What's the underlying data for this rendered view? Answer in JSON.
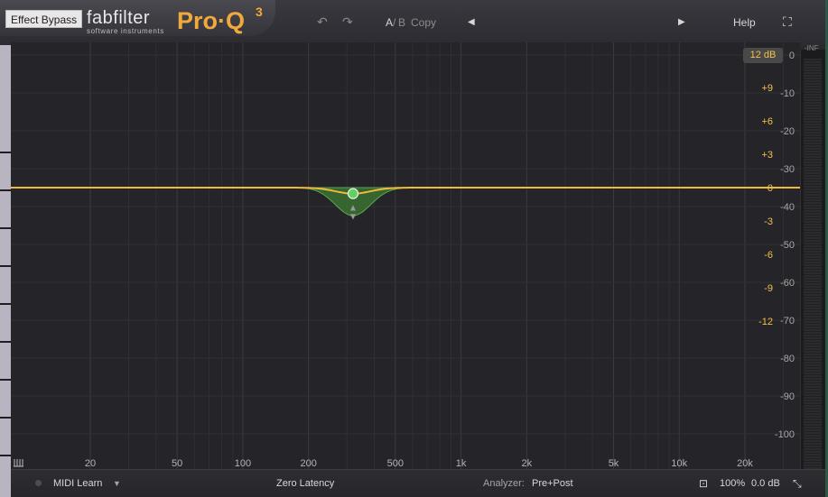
{
  "header": {
    "effect_bypass": "Effect Bypass",
    "logo_brand": "fabfilter",
    "logo_sub": "software instruments",
    "logo_product": "Pro·Q",
    "logo_version": "3",
    "undo_icon": "↶",
    "redo_icon": "↷",
    "ab_a": "A",
    "ab_sep": "/",
    "ab_b": "B",
    "copy": "Copy",
    "prev_icon": "◀",
    "next_icon": "▶",
    "help": "Help",
    "fullscreen_icon": "⛶"
  },
  "graph": {
    "range_badge": "12 dB",
    "meter_inf": "-INF",
    "gain_labels": [
      "+9",
      "+6",
      "+3",
      "0",
      "-3",
      "-6",
      "-9",
      "-12"
    ],
    "meter_labels": [
      "0",
      "-10",
      "-20",
      "-30",
      "-40",
      "-50",
      "-60",
      "-70",
      "-80",
      "-90",
      "-100"
    ],
    "freq_labels": [
      "20",
      "50",
      "100",
      "200",
      "500",
      "1k",
      "2k",
      "5k",
      "10k",
      "20k"
    ],
    "band": {
      "freq": 320,
      "gain_db": -1.2,
      "shape": "bell",
      "color": "#4caf50"
    },
    "curve_color": "#f0b93a",
    "gain_label_color": "#f2c24b"
  },
  "bottom": {
    "midi_learn": "MIDI Learn",
    "dropdown_icon": "▼",
    "latency": "Zero Latency",
    "analyzer_label": "Analyzer:",
    "analyzer_value": "Pre+Post",
    "save_icon": "⊡",
    "zoom": "100%",
    "output_gain": "0.0 dB",
    "resize_icon": "⤡"
  }
}
